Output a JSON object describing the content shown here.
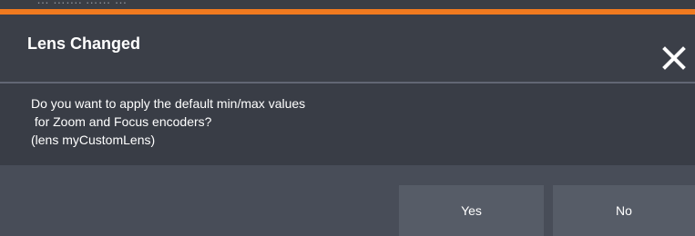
{
  "background_strip": {
    "text": "… ……. …… …"
  },
  "dialog": {
    "title": "Lens Changed",
    "close_icon": "close-icon",
    "message": "Do you want to apply the default min/max values\n for Zoom and Focus encoders?\n(lens myCustomLens)",
    "buttons": {
      "yes_label": "Yes",
      "no_label": "No"
    }
  },
  "colors": {
    "accent": "#f07a1f",
    "header_bg": "#3b3f48",
    "body_bg": "#393d46",
    "footer_bg": "#484d58",
    "button_bg": "#565c67",
    "text": "#ffffff"
  }
}
